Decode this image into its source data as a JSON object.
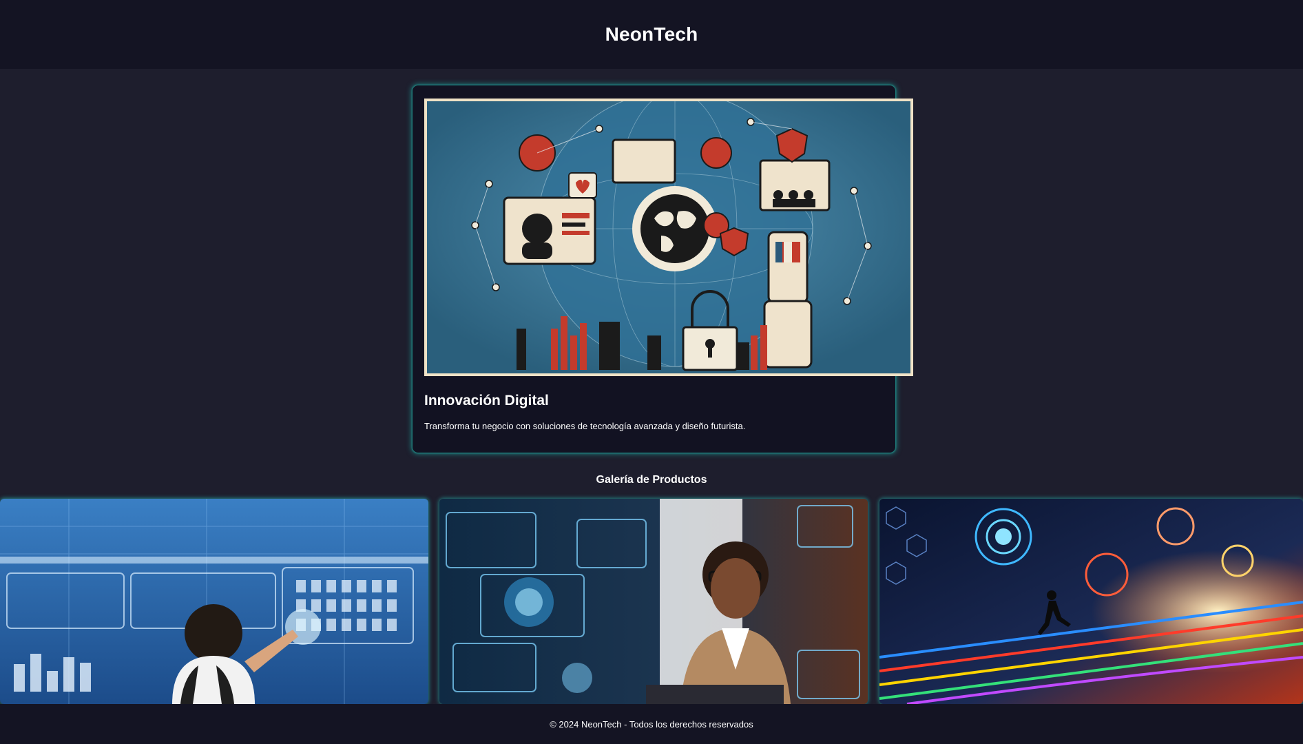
{
  "header": {
    "brand": "NeonTech"
  },
  "feature": {
    "image_alt": "digital-innovation-collage",
    "title": "Innovación Digital",
    "description": "Transforma tu negocio con soluciones de tecnología avanzada y diseño futurista."
  },
  "gallery": {
    "title": "Galería de Productos",
    "items": [
      {
        "image": "student-touchscreen-interface"
      },
      {
        "image": "woman-holographic-workspace"
      },
      {
        "image": "neon-cyber-runner"
      }
    ]
  },
  "footer": {
    "text": "© 2024 NeonTech - Todos los derechos reservados"
  },
  "colors": {
    "header_bg": "#141423",
    "page_bg": "#1e1e2d",
    "card_bg": "#121222",
    "glow": "#28d2c8"
  }
}
